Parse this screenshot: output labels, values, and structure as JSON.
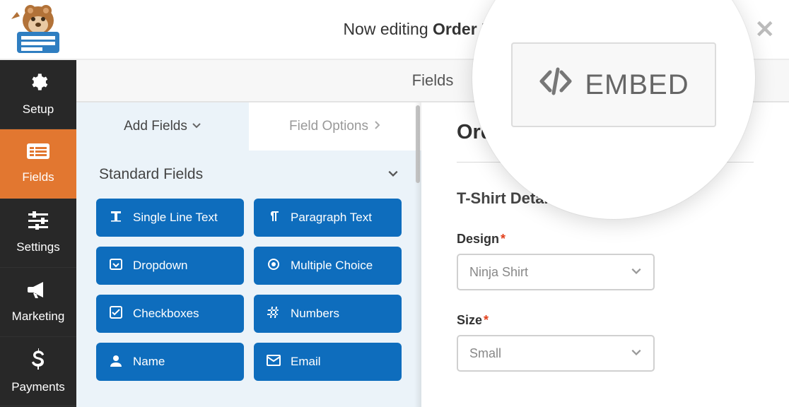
{
  "header": {
    "editing_prefix": "Now editing",
    "form_name": "Order Form"
  },
  "embed": {
    "label": "EMBED"
  },
  "subheader": {
    "title": "Fields"
  },
  "sidebar": [
    {
      "label": "Setup",
      "icon": "gear"
    },
    {
      "label": "Fields",
      "icon": "list"
    },
    {
      "label": "Settings",
      "icon": "sliders"
    },
    {
      "label": "Marketing",
      "icon": "bullhorn"
    },
    {
      "label": "Payments",
      "icon": "dollar"
    }
  ],
  "panel_tabs": {
    "add_fields": "Add Fields",
    "field_options": "Field Options"
  },
  "group": {
    "title": "Standard Fields"
  },
  "field_buttons": [
    {
      "label": "Single Line Text",
      "icon": "text"
    },
    {
      "label": "Paragraph Text",
      "icon": "paragraph"
    },
    {
      "label": "Dropdown",
      "icon": "dropdown"
    },
    {
      "label": "Multiple Choice",
      "icon": "radio"
    },
    {
      "label": "Checkboxes",
      "icon": "check"
    },
    {
      "label": "Numbers",
      "icon": "hash"
    },
    {
      "label": "Name",
      "icon": "user"
    },
    {
      "label": "Email",
      "icon": "mail"
    }
  ],
  "preview": {
    "form_title_short": "Orde",
    "section_title": "T-Shirt Details",
    "design": {
      "label": "Design",
      "value": "Ninja Shirt",
      "required": true
    },
    "size": {
      "label": "Size",
      "value": "Small",
      "required": true
    },
    "required_marker": "*"
  }
}
